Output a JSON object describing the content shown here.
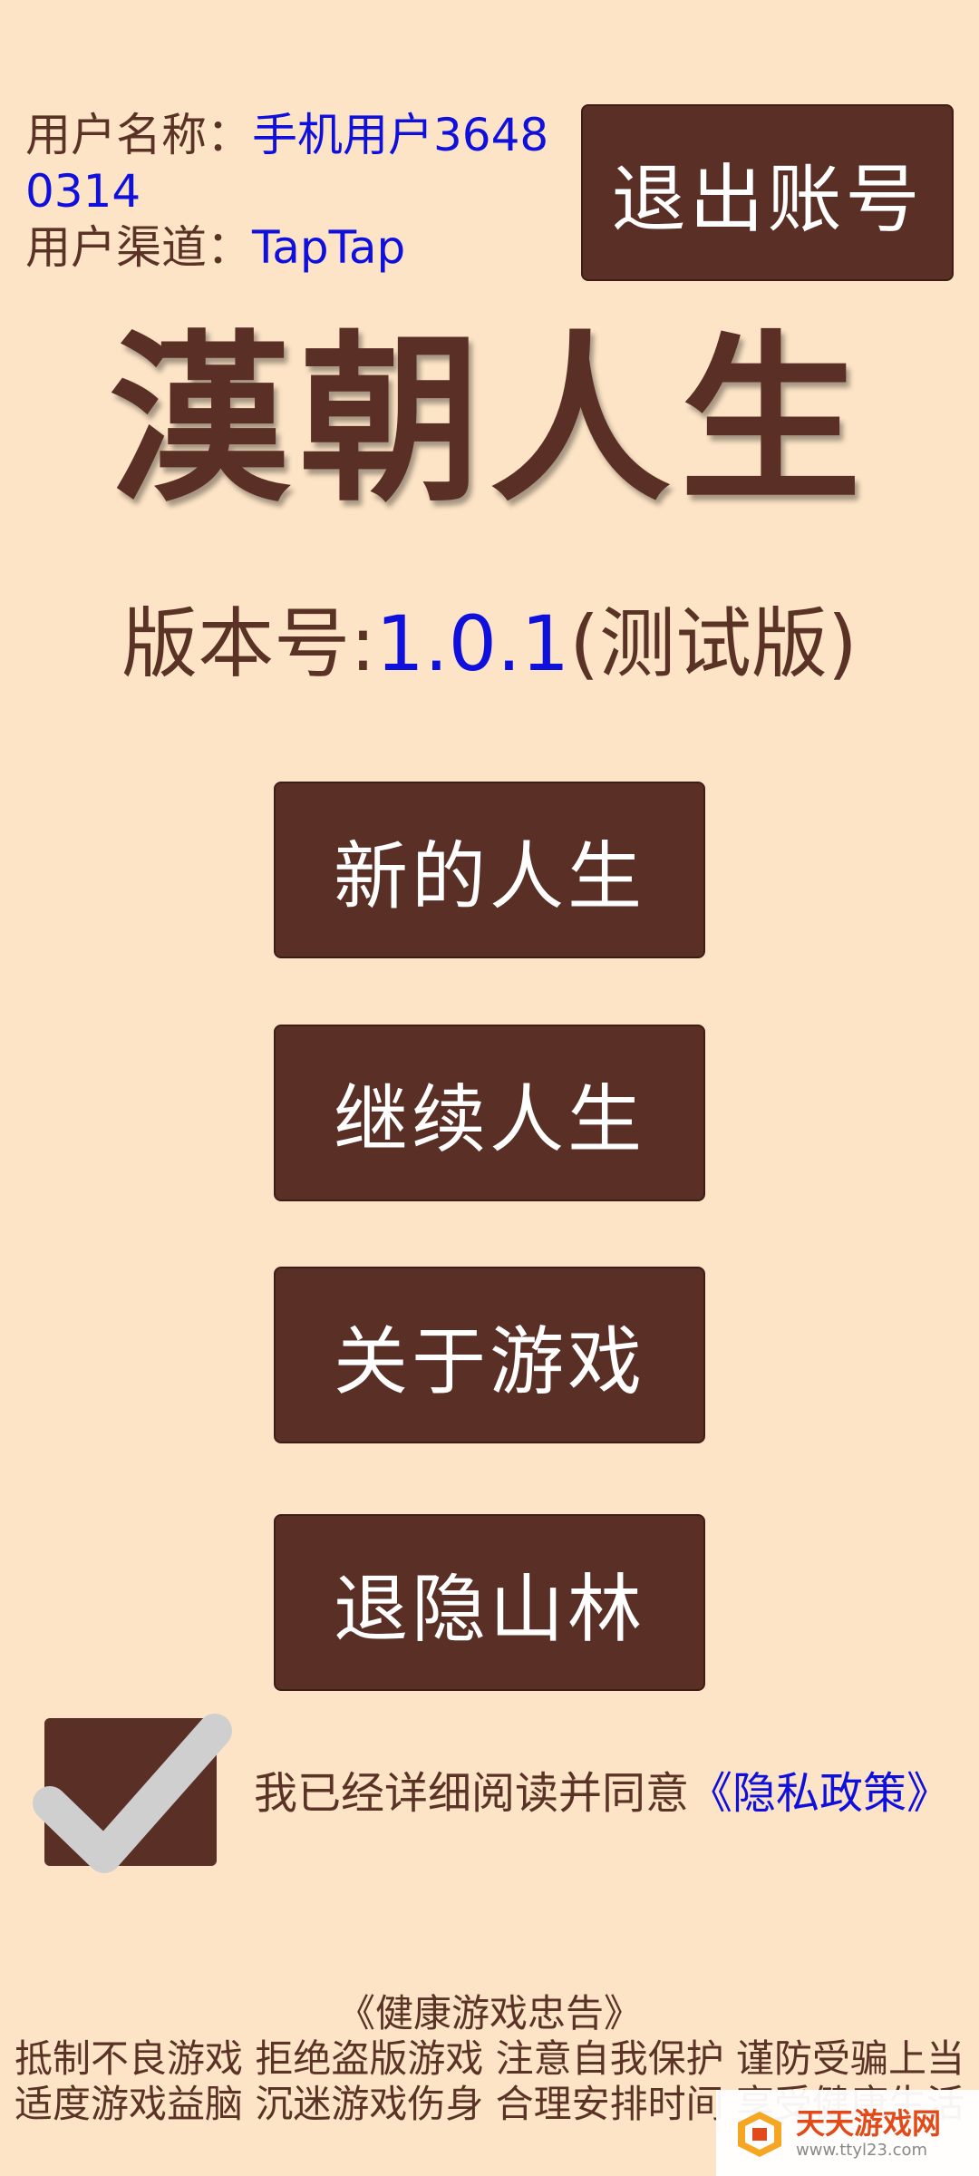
{
  "user": {
    "name_label": "用户名称：",
    "name_value_line1": "手机用户3648",
    "name_value_line2": "0314",
    "channel_label": "用户渠道：",
    "channel_value": "TapTap"
  },
  "header": {
    "logout_label": "退出账号"
  },
  "title": "漢朝人生",
  "version": {
    "prefix": "版本号:",
    "number": "1.0.1",
    "suffix": "(测试版)"
  },
  "menu": {
    "new_life": "新的人生",
    "continue_life": "继续人生",
    "about_game": "关于游戏",
    "quit": "退隐山林"
  },
  "agreement": {
    "checked": true,
    "text": "我已经详细阅读并同意",
    "policy_link": "《隐私政策》"
  },
  "health_notice": {
    "title": "《健康游戏忠告》",
    "line1": "抵制不良游戏 拒绝盗版游戏 注意自我保护 谨防受骗上当",
    "line2": "适度游戏益脑 沉迷游戏伤身 合理安排时间 享受健康生活"
  },
  "watermark": {
    "name": "天天游戏网",
    "url": "www.ttyl23.com"
  },
  "colors": {
    "background": "#fde4c6",
    "button": "#5a3026",
    "link": "#1010dd",
    "text": "#5a3326"
  }
}
